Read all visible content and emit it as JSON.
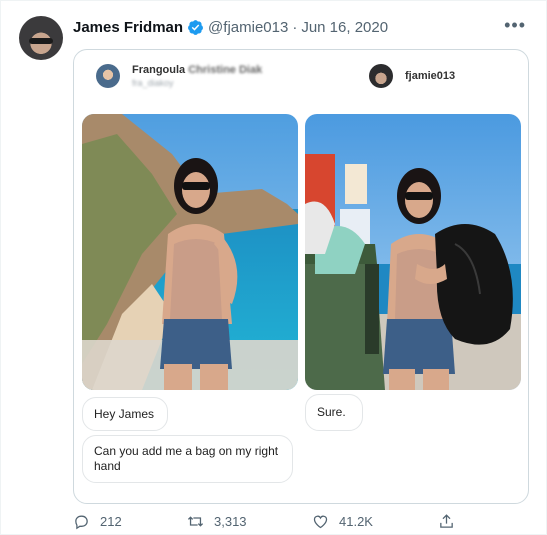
{
  "tweet": {
    "author_name": "James Fridman",
    "handle": "@fjamie013",
    "separator": "·",
    "date": "Jun 16, 2020",
    "more_label": "•••",
    "verified": true
  },
  "card": {
    "left": {
      "user_name_prefix": "Frangoula ",
      "user_name_blurred": "Christine Diak",
      "user_handle_blurred": "fra_diakoy",
      "messages": [
        "Hey James",
        "Can you add me a bag on my right hand"
      ]
    },
    "right": {
      "user_name": "fjamie013",
      "messages": [
        "Sure."
      ]
    }
  },
  "actions": {
    "replies": "212",
    "retweets": "3,313",
    "likes": "41.2K"
  },
  "colors": {
    "accent": "#1d9bf0",
    "muted": "#536471",
    "border": "#cfd9de"
  },
  "icons": [
    "verified-badge-icon",
    "more-icon",
    "reply-icon",
    "retweet-icon",
    "like-icon",
    "share-icon"
  ]
}
